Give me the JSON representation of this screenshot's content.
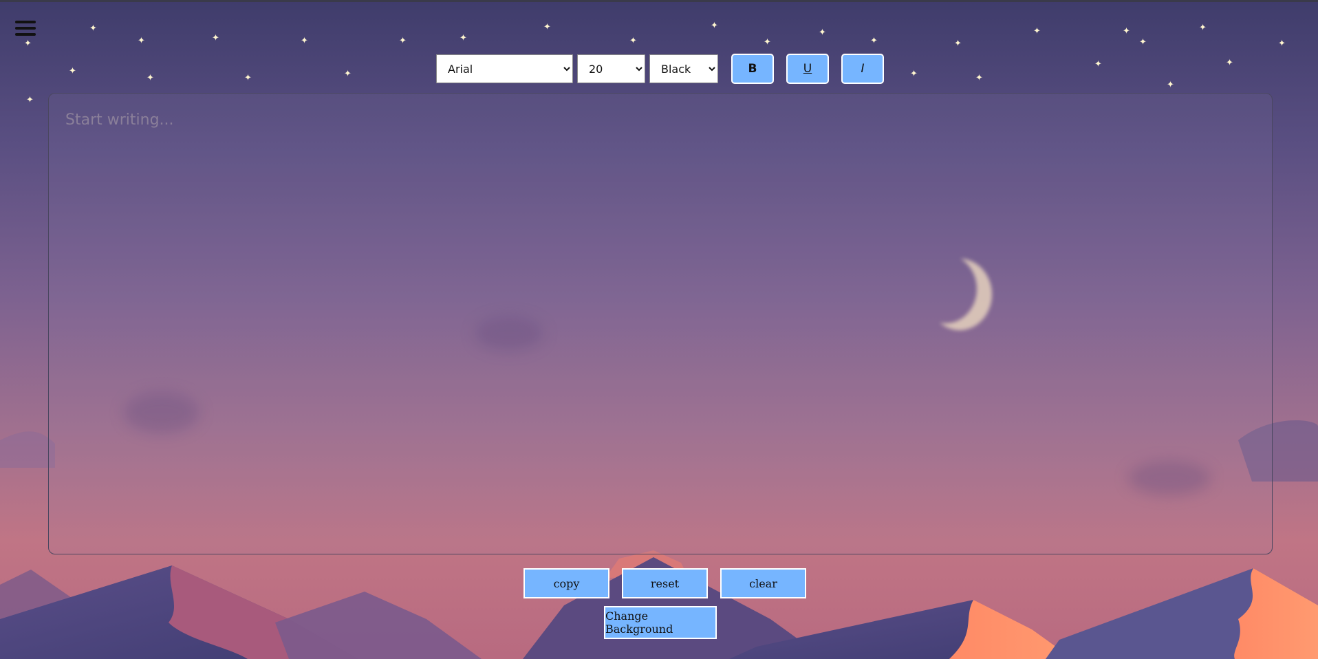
{
  "toolbar": {
    "font_family": "Arial",
    "font_size": "20",
    "font_color": "Black",
    "bold_label": "B",
    "underline_label": "U",
    "italic_label": "I"
  },
  "editor": {
    "placeholder": "Start writing..."
  },
  "actions": {
    "copy_label": "copy",
    "reset_label": "reset",
    "clear_label": "clear",
    "change_background_label": "Change Background"
  },
  "icons": {
    "menu": "hamburger-menu-icon",
    "star": "star-icon",
    "moon": "crescent-moon-icon"
  },
  "colors": {
    "button_fill": "#76b5ff",
    "button_border": "#ffffff",
    "sky_top": "#3f3c6b",
    "sky_bottom": "#c07585"
  }
}
